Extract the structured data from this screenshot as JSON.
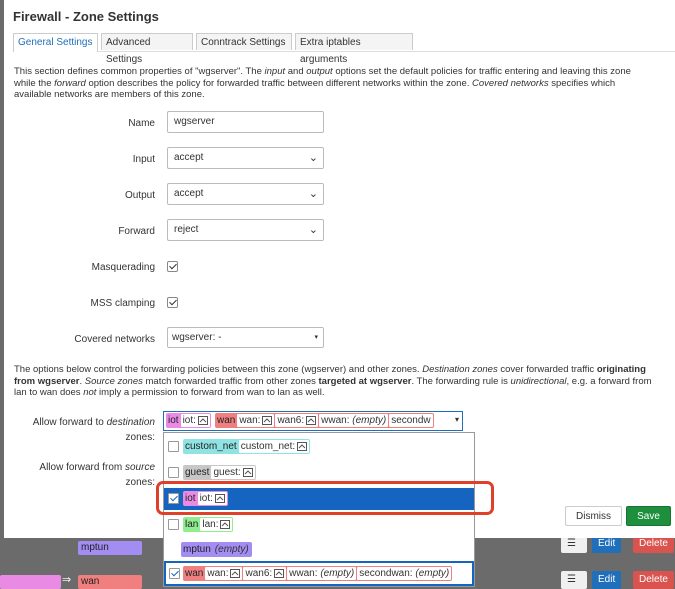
{
  "modal": {
    "title": "Firewall - Zone Settings",
    "tabs": [
      "General Settings",
      "Advanced Settings",
      "Conntrack Settings",
      "Extra iptables arguments"
    ],
    "active_tab": "General Settings",
    "intro": {
      "p1": "This section defines common properties of \"wgserver\". The ",
      "p2": "input",
      "p3": " and ",
      "p4": "output",
      "p5": " options set the default policies for traffic entering and leaving this zone while the ",
      "p6": "forward",
      "p7": " option describes the policy for forwarded traffic between different networks within the zone. ",
      "p8": "Covered networks",
      "p9": " specifies which available networks are members of this zone."
    },
    "fields": {
      "name_label": "Name",
      "name_value": "wgserver",
      "input_label": "Input",
      "input_value": "accept",
      "output_label": "Output",
      "output_value": "accept",
      "forward_label": "Forward",
      "forward_value": "reject",
      "masq_label": "Masquerading",
      "mss_label": "MSS clamping",
      "covered_label": "Covered networks",
      "covered_value": "wgserver: -"
    },
    "fwd_desc": {
      "p1": "The options below control the forwarding policies between this zone (wgserver) and other zones. ",
      "p2": "Destination zones",
      "p3": " cover forwarded traffic ",
      "p4": "originating from wgserver",
      "p5": ". ",
      "p6": "Source zones",
      "p7": " match forwarded traffic from other zones ",
      "p8": "targeted at wgserver",
      "p9": ". The forwarding rule is ",
      "p10": "unidirectional",
      "p11": ", e.g. a forward from lan to wan does ",
      "p12": "not",
      "p13": " imply a permission to forward from wan to lan as well."
    },
    "allow_dest_label_1": "Allow forward to ",
    "allow_dest_label_2": "destination",
    "allow_dest_label_3": "zones:",
    "allow_src_label_1": "Allow forward from ",
    "allow_src_label_2": "source",
    "allow_src_label_3": "zones:",
    "selected_chips": {
      "iot": "iot",
      "iot_net": "iot:",
      "wan": "wan",
      "wan_net": "wan:",
      "wan6_net": "wan6:",
      "wwan_net": "wwan:",
      "empty": "(empty)",
      "secondwan_net": "secondw"
    },
    "menu": {
      "custom_net": "custom_net",
      "custom_net_net": "custom_net:",
      "guest": "guest",
      "guest_net": "guest:",
      "iot": "iot",
      "iot_net": "iot:",
      "lan": "lan",
      "lan_net": "lan:",
      "mptun": "mptun",
      "mptun_empty": "(empty)",
      "wan": "wan",
      "wan_net": "wan:",
      "wan6_net": "wan6:",
      "wwan_net": "wwan:",
      "wwan_empty": "(empty)",
      "secondwan_net": "secondwan:",
      "secondwan_empty": "(empty)"
    },
    "buttons": {
      "dismiss": "Dismiss",
      "save": "Save"
    }
  },
  "background": {
    "mptun": "mptun",
    "arrow": "⇒",
    "wan": "wan",
    "menu_icon": "☰",
    "edit": "Edit",
    "delete_1": "Delete",
    "delete_2": "Delete"
  },
  "colors": {
    "iot": "#e98be5",
    "wan": "#f08080",
    "custom_net": "#8fe3e3",
    "guest": "#c7c7c7",
    "lan": "#90ee90",
    "mptun": "#a38cf2",
    "selected_row": "#1565c0",
    "save": "#1e8f3c"
  }
}
